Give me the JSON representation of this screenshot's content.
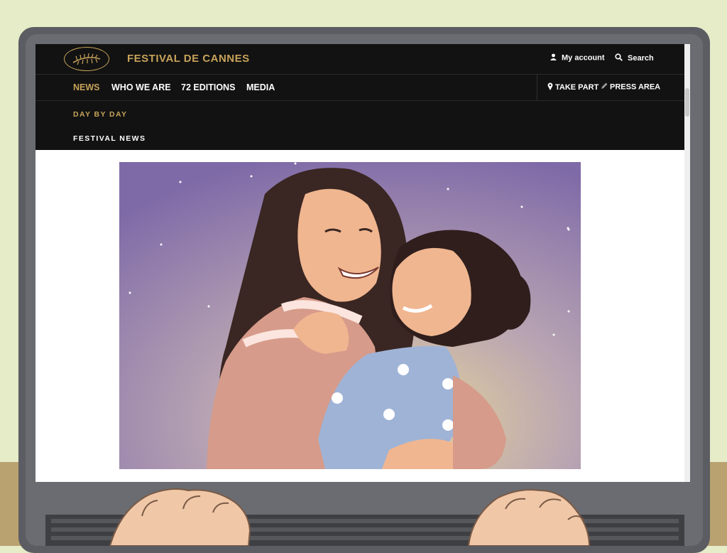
{
  "brand": {
    "logo_icon": "palm-leaf-icon",
    "name": "FESTIVAL DE CANNES",
    "color": "#c7a35a"
  },
  "utility": {
    "account": "My account",
    "search": "Search"
  },
  "nav": {
    "items": [
      {
        "label": "NEWS",
        "active": true
      },
      {
        "label": "WHO WE ARE",
        "active": false
      },
      {
        "label": "72 EDITIONS",
        "active": false
      },
      {
        "label": "MEDIA",
        "active": false
      }
    ],
    "take_part": "TAKE PART",
    "press_area": "PRESS AREA"
  },
  "subnav": {
    "items": [
      "DAY BY DAY",
      "FESTIVAL NEWS"
    ]
  },
  "content": {
    "image_description_icon": "mother-daughter-hug-illustration"
  },
  "colors": {
    "header_bg": "#121212",
    "accent_gold": "#c7a35a",
    "page_bg": "#ffffff"
  }
}
